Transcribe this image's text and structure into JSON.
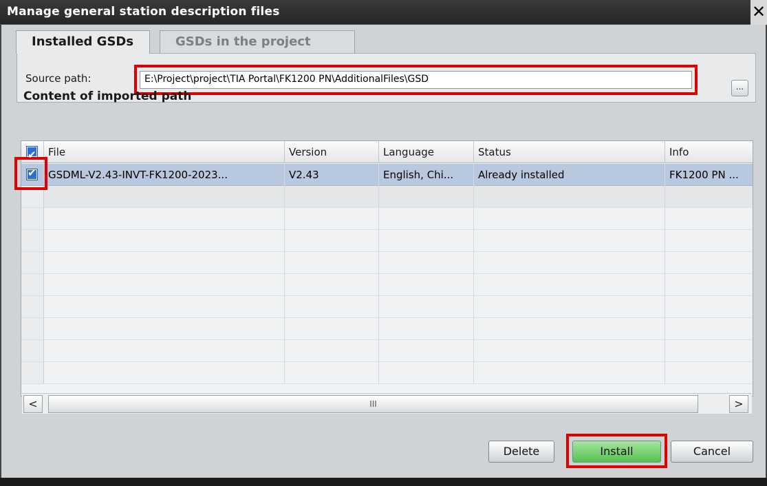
{
  "window": {
    "title": "Manage general station description files",
    "close_glyph": "✕"
  },
  "tabs": [
    {
      "label": "Installed GSDs",
      "active": true
    },
    {
      "label": "GSDs in the project",
      "active": false
    }
  ],
  "source": {
    "label": "Source path:",
    "value": "E:\\Project\\project\\TIA Portal\\FK1200 PN\\AdditionalFiles\\GSD",
    "browse_label": "..."
  },
  "content_section": {
    "title": "Content of imported path"
  },
  "table": {
    "columns": [
      "File",
      "Version",
      "Language",
      "Status",
      "Info"
    ],
    "header_checked": true,
    "rows": [
      {
        "checked": true,
        "selected": true,
        "file": "GSDML-V2.43-INVT-FK1200-2023...",
        "version": "V2.43",
        "language": "English, Chi...",
        "status": "Already installed",
        "info": "FK1200 PN ..."
      }
    ]
  },
  "scrollbar": {
    "left_arrow": "<",
    "right_arrow": ">",
    "thumb_grip": "III"
  },
  "buttons": {
    "delete": "Delete",
    "install": "Install",
    "cancel": "Cancel"
  },
  "colors": {
    "highlight": "#e00000",
    "selection": "#b8c8de",
    "install_button": "#55c050"
  }
}
